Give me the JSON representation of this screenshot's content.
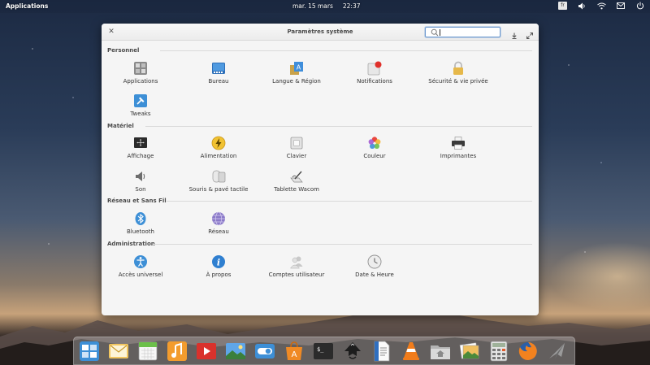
{
  "top_panel": {
    "applications_label": "Applications",
    "date": "mar. 15 mars",
    "time": "22:37",
    "keyboard_layout": "fr"
  },
  "window": {
    "title": "Paramètres système",
    "search": {
      "value": "",
      "placeholder": ""
    }
  },
  "sections": {
    "personnel": {
      "header": "Personnel",
      "items": [
        "Applications",
        "Bureau",
        "Langue & Région",
        "Notifications",
        "Sécurité & vie privée",
        "Tweaks"
      ]
    },
    "materiel": {
      "header": "Matériel",
      "items": [
        "Affichage",
        "Alimentation",
        "Clavier",
        "Couleur",
        "Imprimantes",
        "Son",
        "Souris & pavé tactile",
        "Tablette Wacom"
      ]
    },
    "reseau": {
      "header": "Réseau et Sans Fil",
      "items": [
        "Bluetooth",
        "Réseau"
      ]
    },
    "administration": {
      "header": "Administration",
      "items": [
        "Accès universel",
        "À propos",
        "Comptes utilisateur",
        "Date & Heure"
      ]
    }
  },
  "icons": {
    "personnel": [
      "applications-icon",
      "desktop-icon",
      "language-icon",
      "notifications-icon",
      "security-lock-icon",
      "tweaks-hammer-icon"
    ],
    "materiel": [
      "display-icon",
      "power-icon",
      "keyboard-icon",
      "color-icon",
      "printer-icon",
      "sound-icon",
      "mouse-icon",
      "wacom-tablet-icon"
    ],
    "reseau": [
      "bluetooth-icon",
      "network-globe-icon"
    ],
    "administration": [
      "accessibility-icon",
      "about-info-icon",
      "user-accounts-icon",
      "date-time-clock-icon"
    ]
  },
  "dock": {
    "apps": [
      "multitasking-view-icon",
      "mail-icon",
      "calendar-icon",
      "music-icon",
      "videos-icon",
      "photos-icon",
      "system-settings-icon",
      "appcenter-icon",
      "terminal-icon",
      "inkscape-icon",
      "document-writer-icon",
      "vlc-icon",
      "files-icon",
      "image-viewer-icon",
      "calculator-icon",
      "firefox-icon",
      "send-tool-icon"
    ]
  },
  "colors": {
    "accent": "#3d8fd6",
    "window_bg": "#f5f5f5",
    "notification_dot": "#e0302a"
  }
}
